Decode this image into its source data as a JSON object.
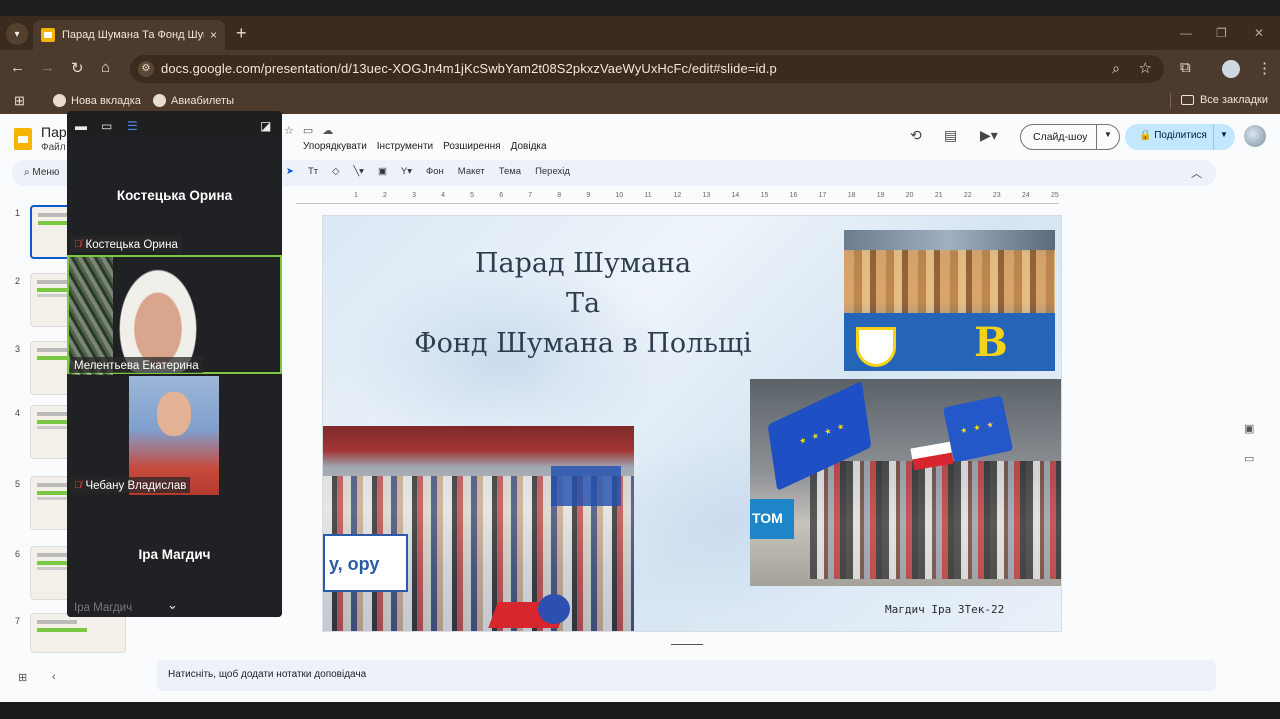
{
  "browser": {
    "tab_title": "Парад Шумана Та Фонд Шума",
    "tab_close": "×",
    "new_tab": "+",
    "url": "docs.google.com/presentation/d/13uec-XOGJn4m1jKcSwbYam2t08S2pkxzVaeWyUxHcFc/edit#slide=id.p",
    "window_controls": [
      "—",
      "❐",
      "✕"
    ],
    "bookmarks": [
      "Нова вкладка",
      "Авиабилеты"
    ],
    "all_bookmarks": "Все закладки"
  },
  "slides_app": {
    "doc_title": "Пара",
    "menu_file": "Файл",
    "menus": [
      "Упорядкувати",
      "Інструменти",
      "Розширення",
      "Довідка"
    ],
    "slideshow_label": "Слайд-шоу",
    "share_label": "Поділитися",
    "menu_search": "Меню",
    "tools": [
      "Тт",
      "Фон",
      "Макет",
      "Тема",
      "Перехід"
    ],
    "ruler_ticks": [
      "1",
      "2",
      "3",
      "4",
      "5",
      "6",
      "7",
      "8",
      "9",
      "10",
      "11",
      "12",
      "13",
      "14",
      "15",
      "16",
      "17",
      "18",
      "19",
      "20",
      "21",
      "22",
      "23",
      "24",
      "25"
    ],
    "slide_numbers": [
      "1",
      "2",
      "3",
      "4",
      "5",
      "6",
      "7"
    ],
    "notes_placeholder": "Натисніть, щоб додати нотатки доповідача"
  },
  "slide": {
    "title_lines": [
      "Парад Шумана",
      "Та",
      "Фонд Шумана в Польщі"
    ],
    "author": "Магдич Іра 3Тек-22",
    "photo1_text": "B",
    "photo2_banner": "у, ору",
    "photo3_sign": "ТОМ"
  },
  "meet": {
    "participants": [
      {
        "name": "Костецька Орина",
        "label": "Костецька Орина",
        "mic_muted": true
      },
      {
        "name": "Мелентьева Екатерина",
        "label": "Мелентьева Екатерина",
        "mic_muted": false
      },
      {
        "name": "Чебану Владислав",
        "label": "Чебану Владислав",
        "mic_muted": true
      },
      {
        "name": "Іра Магдич",
        "label": "Іра Магдич",
        "mic_muted": false
      }
    ]
  },
  "colors": {
    "accent_blue": "#0b57d0",
    "share_bg": "#c2e7ff",
    "speaking_border": "#7bc943",
    "browser_frame": "#4c3a2c"
  }
}
